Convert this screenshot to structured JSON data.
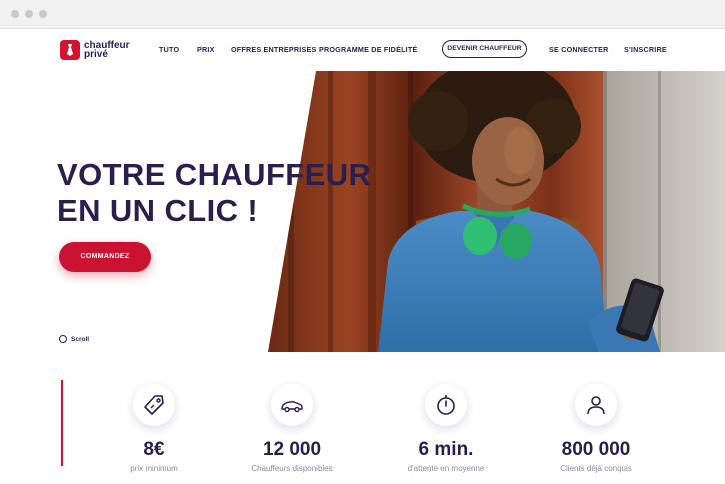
{
  "header": {
    "logo_text_line1": "chauffeur",
    "logo_text_line2": "privé",
    "nav": [
      {
        "label": "TUTO"
      },
      {
        "label": "PRIX"
      },
      {
        "label": "OFFRES ENTREPRISES"
      },
      {
        "label": "PROGRAMME DE FIDÉLITÉ"
      }
    ],
    "become_driver_label": "DEVENIR CHAUFFEUR",
    "login_label": "SE CONNECTER",
    "separator": "·",
    "signup_label": "S'INSCRIRE"
  },
  "hero": {
    "title_line1": "VOTRE CHAUFFEUR",
    "title_line2": "EN UN CLIC !",
    "cta_label": "COMMANDEZ",
    "scroll_label": "Scroll"
  },
  "stats": [
    {
      "icon": "price-tag-icon",
      "value": "8€",
      "label": "prix minimum"
    },
    {
      "icon": "car-icon",
      "value": "12 000",
      "label": "Chauffeurs disponibles"
    },
    {
      "icon": "timer-icon",
      "value": "6 min.",
      "label": "d'attente en moyenne"
    },
    {
      "icon": "user-icon",
      "value": "800 000",
      "label": "Clients déjà conquis"
    }
  ],
  "colors": {
    "brand_red": "#d3142f",
    "navy": "#2a1e4d",
    "muted": "#8d89a3"
  }
}
